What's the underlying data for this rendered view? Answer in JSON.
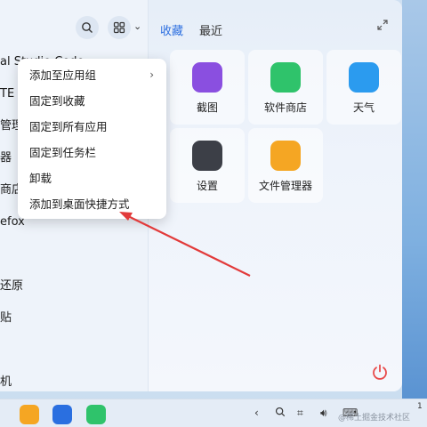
{
  "launcher": {
    "left_list": [
      {
        "label": "al Studio Code",
        "dot": true
      },
      {
        "label": "TE 终",
        "dot": false
      },
      {
        "label": "管理",
        "dot": false
      },
      {
        "label": "器",
        "dot": false
      },
      {
        "label": "商店",
        "dot": false
      },
      {
        "label": "efox",
        "dot": false
      },
      {
        "label": "",
        "dot": false
      },
      {
        "label": "还原",
        "dot": false
      },
      {
        "label": "贴",
        "dot": false
      },
      {
        "label": "",
        "dot": false
      },
      {
        "label": "机",
        "dot": false
      }
    ],
    "tabs": [
      {
        "label": "收藏",
        "active": true
      },
      {
        "label": "最近",
        "active": false
      }
    ],
    "apps": [
      {
        "label": "截图",
        "icon": "screenshot-icon",
        "color": "#8a4fe0"
      },
      {
        "label": "软件商店",
        "icon": "store-icon",
        "color": "#2fc36b"
      },
      {
        "label": "天气",
        "icon": "weather-icon",
        "color": "#2b9bef"
      },
      {
        "label": "设置",
        "icon": "settings-icon",
        "color": "#3c3f47"
      },
      {
        "label": "文件管理器",
        "icon": "file-manager-icon",
        "color": "#f5a623"
      }
    ]
  },
  "context_menu": {
    "items": [
      {
        "label": "添加至应用组",
        "submenu": true
      },
      {
        "label": "固定到收藏",
        "submenu": false
      },
      {
        "label": "固定到所有应用",
        "submenu": false
      },
      {
        "label": "固定到任务栏",
        "submenu": false
      },
      {
        "label": "卸载",
        "submenu": false
      },
      {
        "label": "添加到桌面快捷方式",
        "submenu": false
      }
    ]
  },
  "taskbar": {
    "pinned": [
      {
        "icon": "file-manager-icon",
        "color": "#f5a623"
      },
      {
        "icon": "wps-icon",
        "color": "#2a6fe0"
      },
      {
        "icon": "store-icon",
        "color": "#2fc36b"
      }
    ],
    "watermark": "@稀土掘金技术社区",
    "clock": "1"
  },
  "colors": {
    "accent": "#2d6fe0",
    "annotation": "#e23a3a",
    "power": "#e84a4a"
  }
}
